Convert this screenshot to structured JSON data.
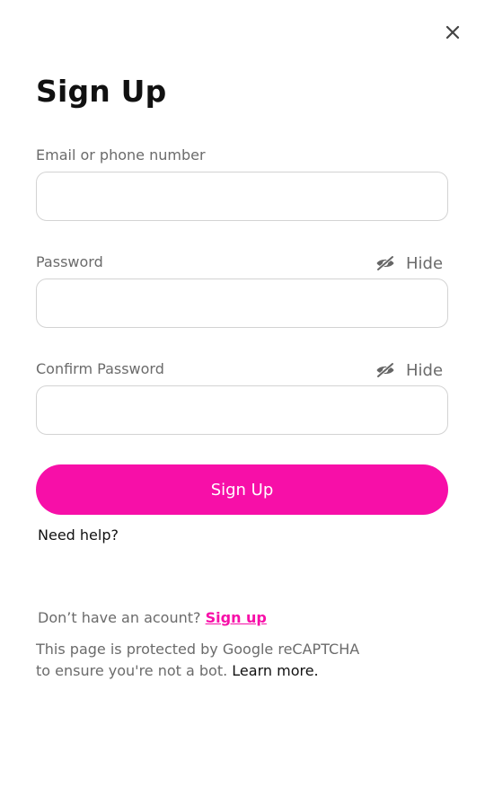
{
  "header": {
    "title": "Sign Up"
  },
  "fields": {
    "email": {
      "label": "Email or phone number",
      "value": "",
      "placeholder": ""
    },
    "password": {
      "label": "Password",
      "toggle_label": "Hide",
      "value": "",
      "placeholder": ""
    },
    "confirm": {
      "label": "Confirm Password",
      "toggle_label": "Hide",
      "value": "",
      "placeholder": ""
    }
  },
  "actions": {
    "signup_button": "Sign Up",
    "need_help": "Need help?"
  },
  "footer": {
    "account_prompt": "Don’t have an acount?",
    "signup_link": "Sign up",
    "captcha_line1": "This page is protected by Google reCAPTCHA",
    "captcha_line2": "to ensure you're not a bot.",
    "learn_more": "Learn more."
  },
  "colors": {
    "accent": "#f70fa8",
    "muted_text": "#6b6b6b",
    "border": "#d3d3d3"
  },
  "icons": {
    "close": "close-icon",
    "hide": "eye-slash-icon"
  }
}
